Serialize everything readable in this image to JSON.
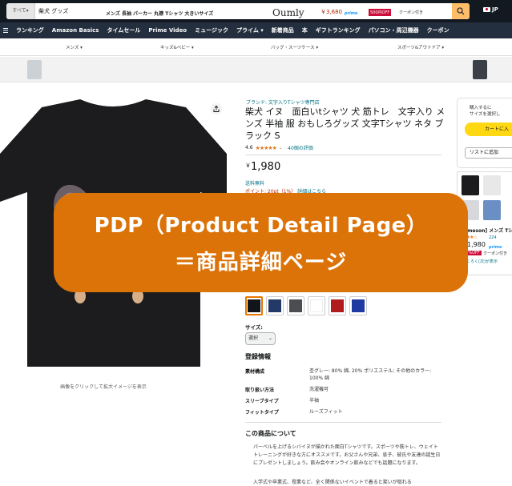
{
  "search": {
    "category": "すべて",
    "query": "柴犬 グッズ"
  },
  "locale": {
    "lang": "JP"
  },
  "nav": {
    "items": [
      "ランキング",
      "Amazon Basics",
      "タイムセール",
      "Prime Video",
      "ミュージック",
      "プライム",
      "新着商品",
      "本",
      "ギフトランキング",
      "パソコン・周辺機器",
      "クーポン"
    ]
  },
  "subnav": {
    "items": [
      "メンズ",
      "キッズ&ベビー",
      "バッグ・スーツケース",
      "スポーツ&アウトドア"
    ]
  },
  "banner": {
    "text": "メンズ 長袖 パーカー 丸襟 Tシャツ 大きいサイズ",
    "brand": "Oumly",
    "price": "￥3,680",
    "prime": "prime",
    "badge": "500円OFF",
    "coupon": "クーポン付き"
  },
  "product": {
    "brand_link": "ブランド: 文字入りTシャツ専門店",
    "title": "柴犬 イヌ　面白いtシャツ 犬 筋トレ　文字入り メンズ 半袖 服 おもしろグッズ 文字Tシャツ ネタ ブラック S",
    "rating_value": "4.6",
    "stars": "★★★★★",
    "rating_count": "40個の評価",
    "price_currency": "￥",
    "price": "1,980",
    "shipping": "送料無料",
    "points": "ポイント: 20pt（1%）",
    "points_link": "詳細はこちら",
    "image_caption": "画像をクリックして拡大イメージを表示",
    "colors": [
      "#111418",
      "#243a66",
      "#4b4d50",
      "#ffffff",
      "#b01c1c",
      "#1f3aa0"
    ],
    "size_label": "サイズ:",
    "size_value": "選択"
  },
  "specs": {
    "title": "登録情報",
    "rows": [
      {
        "key": "素材構成",
        "value": "杢グレー: 80% 綿, 20% ポリエステル; その他のカラー: 100% 綿"
      },
      {
        "key": "取り扱い方法",
        "value": "洗濯機可"
      },
      {
        "key": "スリーブタイプ",
        "value": "半袖"
      },
      {
        "key": "フィットタイプ",
        "value": "ルーズフィット"
      }
    ]
  },
  "about": {
    "title": "この商品について",
    "text": "パーベルを上げるシバイヌが描かれた面白Tシャツです。スポーツや筋トレ、ウェイトトレーニングが好きな方にオススメです。お父さんや兄弟、息子、彼氏や友達の誕生日にプレゼントしましょう。飲み会やオンライン飲みなどでも話題になります。",
    "text2": "入学式や卒業式、授業など、全く関係ないイベントで着ると笑いが取れる"
  },
  "buybox": {
    "text_line1": "購入するに",
    "text_line2": "サイズを選択し",
    "cart_label": "カートに入",
    "list_label": "リストに追加"
  },
  "sponsored": {
    "name": "[Oumeson] メンズ Tシャ",
    "stars": "★★★★☆",
    "count": "224",
    "price": "1,980",
    "prime": "prime",
    "badge": "15%OFF",
    "coupon": "クーポン付き",
    "note": "もくろく(次)が表示"
  },
  "callout": {
    "line1": "PDP（Product Detail Page）",
    "line2": "＝商品詳細ページ"
  }
}
